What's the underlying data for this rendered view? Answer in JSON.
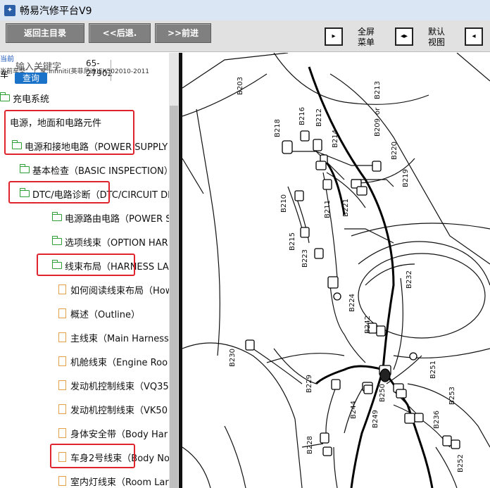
{
  "window": {
    "title": "畅易汽修平台V9",
    "icon": "app-logo-icon"
  },
  "toolbar": {
    "home_label": "返回主目录",
    "back_label": "<<后退.",
    "forward_label": ">>前进",
    "fullscreen_label_1": "全屏",
    "fullscreen_label_2": "菜单",
    "default_view_label_1": "默认",
    "default_view_label_2": "视图",
    "vehicle_info": "当前车型： 厂家:Infiniti(英菲尼迪)FX502010-2011",
    "current_label": "当前"
  },
  "search": {
    "label": "输入关键字",
    "value_line1": "65-",
    "value_line2": "27902",
    "query_button": "查询",
    "left_fragment": "车"
  },
  "tree": {
    "nodes": [
      {
        "label": "充电系统",
        "icon": "folder-icon"
      },
      {
        "label": "电源，地面和电路元件",
        "icon": "none"
      },
      {
        "label": "电源和接地电路（POWER SUPPLY",
        "icon": "folder-icon"
      },
      {
        "label": "基本检查（BASIC INSPECTION）",
        "icon": "folder-icon"
      },
      {
        "label": "DTC/电路诊断（DTC/CIRCUIT DI",
        "icon": "folder-icon"
      },
      {
        "label": "电源路由电路（POWER S",
        "icon": "folder-icon"
      },
      {
        "label": "选项线束（OPTION HAR",
        "icon": "folder-icon"
      },
      {
        "label": "线束布局（HARNESS LA",
        "icon": "folder-icon"
      },
      {
        "label": "如何阅读线束布局（How",
        "icon": "document-icon"
      },
      {
        "label": "概述（Outline）",
        "icon": "document-icon"
      },
      {
        "label": "主线束（Main Harness",
        "icon": "document-icon"
      },
      {
        "label": "机舱线束（Engine Roo",
        "icon": "document-icon"
      },
      {
        "label": "发动机控制线束（VQ35",
        "icon": "document-icon"
      },
      {
        "label": "发动机控制线束（VK50",
        "icon": "document-icon"
      },
      {
        "label": "身体安全带（Body Har",
        "icon": "document-icon"
      },
      {
        "label": "车身2号线束（Body No",
        "icon": "document-icon"
      },
      {
        "label": "室内灯线束（Room Lar",
        "icon": "document-icon"
      }
    ]
  },
  "diagram": {
    "connectors": [
      "B203",
      "B213",
      "B216",
      "B212",
      "B218",
      "B214",
      "B209",
      "or",
      "B220",
      "B219",
      "B210",
      "B211",
      "B221",
      "B215",
      "B223",
      "B232",
      "B224",
      "B242",
      "B230",
      "B229",
      "B251",
      "B250",
      "B244",
      "B249",
      "B253",
      "B236",
      "B228",
      "B252"
    ]
  }
}
